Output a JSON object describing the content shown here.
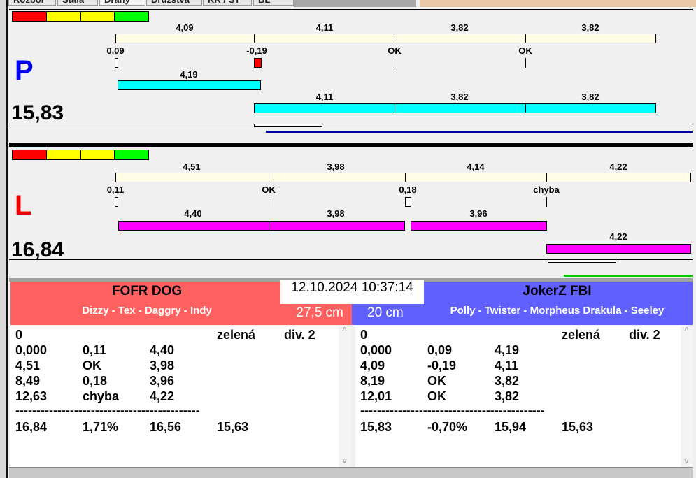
{
  "tabs": [
    "Rozbor",
    "Stála",
    "Dráhy",
    "Družstva",
    "KR / ST",
    "BL"
  ],
  "colors": {
    "red": "#ff0000",
    "yellow": "#ffff00",
    "green": "#00ff00",
    "cream": "#fffde6",
    "cyan": "#00ffff",
    "magenta": "#ff00ff",
    "team_left": "#ff6060",
    "team_right": "#6060ff"
  },
  "lane_p": {
    "letter": "P",
    "total": "15,83",
    "top_segments": [
      "4,09",
      "4,11",
      "3,82",
      "3,82"
    ],
    "reactions": [
      "0,09",
      "-0,19",
      "OK",
      "OK"
    ],
    "run_first": "4,19",
    "run_segments": [
      "4,11",
      "3,82",
      "3,82"
    ]
  },
  "lane_l": {
    "letter": "L",
    "total": "16,84",
    "top_segments": [
      "4,51",
      "3,98",
      "4,14",
      "4,22"
    ],
    "reactions": [
      "0,11",
      "OK",
      "0,18",
      "chyba"
    ],
    "run_segments": [
      "4,40",
      "3,98",
      "3,96"
    ],
    "run_last": "4,22"
  },
  "datetime": "12.10.2024 10:37:14",
  "left_team": {
    "name": "FOFR DOG",
    "dogs": "Dizzy - Tex - Daggry - Indy",
    "height": "27,5 cm",
    "header": [
      "0",
      "",
      "",
      "zelená",
      "div. 2"
    ],
    "rows": [
      [
        "0,000",
        "0,11",
        "4,40"
      ],
      [
        "4,51",
        "OK",
        "3,98"
      ],
      [
        "8,49",
        "0,18",
        "3,96"
      ],
      [
        "12,63",
        "chyba",
        "4,22"
      ]
    ],
    "separator": "--------------------------------------------",
    "totals": [
      "16,84",
      "1,71%",
      "16,56",
      "15,63"
    ]
  },
  "right_team": {
    "name": "JokerZ FBI",
    "dogs": "Polly - Twister - Morpheus Drakula - Seeley",
    "height": "20 cm",
    "header": [
      "0",
      "",
      "",
      "zelená",
      "div. 2"
    ],
    "rows": [
      [
        "0,000",
        "0,09",
        "4,19"
      ],
      [
        "4,09",
        "-0,19",
        "4,11"
      ],
      [
        "8,19",
        "OK",
        "3,82"
      ],
      [
        "12,01",
        "OK",
        "3,82"
      ]
    ],
    "separator": "--------------------------------------------",
    "totals": [
      "15,83",
      "-0,70%",
      "15,94",
      "15,63"
    ]
  }
}
